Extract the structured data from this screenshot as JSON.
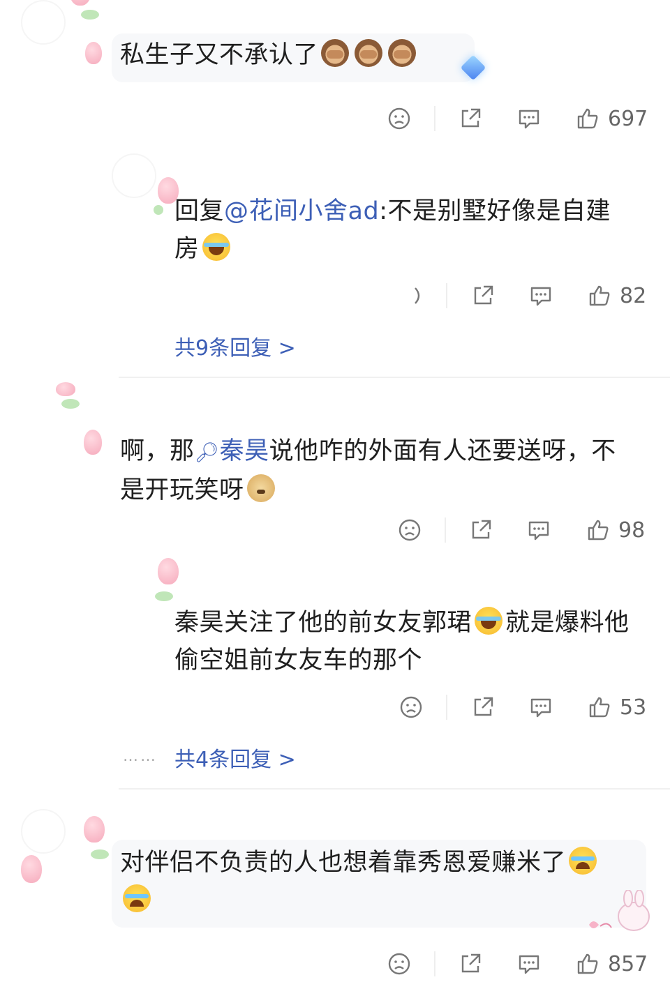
{
  "comments": [
    {
      "text": "私生子又不承认了",
      "likes": "697"
    },
    {
      "reply_prefix": "回复",
      "mention": "@花间小舍ad",
      "text_line1": ":不是别墅好像是自建",
      "text_line2": "房",
      "likes": "82",
      "more_replies": "共9条回复 >"
    },
    {
      "text_part1": "啊，那",
      "search_term": "秦昊",
      "text_part2": "说他咋的外面有人还要送呀，不",
      "text_line2": "是开玩笑呀",
      "likes": "98"
    },
    {
      "text_part1": "秦昊关注了他的前女友郭珺",
      "text_part2": "就是爆料他",
      "text_line2": "偷空姐前女友车的那个",
      "likes": "53",
      "more_replies": "共4条回复 >",
      "dots": "……"
    },
    {
      "text_line1": "对伴侣不负责的人也想着靠秀恩爱赚米了",
      "likes": "857"
    }
  ],
  "icons": {
    "dislike": "dislike-face-icon",
    "share": "share-icon",
    "reply": "comment-icon",
    "like": "thumbs-up-icon"
  },
  "colors": {
    "link": "#3d5fb6",
    "text": "#1f1f1f",
    "meta": "#666666"
  }
}
